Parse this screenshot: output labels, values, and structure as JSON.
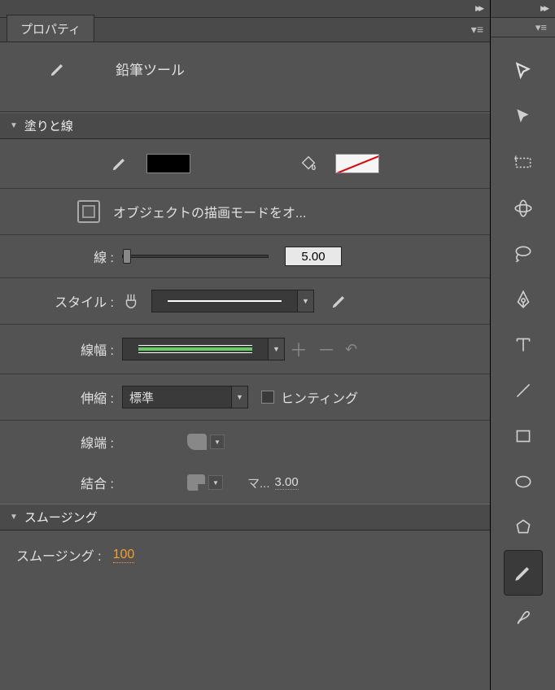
{
  "tab": {
    "title": "プロパティ"
  },
  "tool": {
    "name": "鉛筆ツール"
  },
  "sections": {
    "fillStroke": "塗りと線",
    "smoothing": "スムージング"
  },
  "drawMode": "オブジェクトの描画モードをオ...",
  "labels": {
    "stroke": "線 :",
    "style": "スタイル :",
    "width": "線幅 :",
    "scale": "伸縮 :",
    "cap": "線端 :",
    "join": "結合 :",
    "hinting": "ヒンティング",
    "miterAbbrev": "マ...",
    "smoothing": "スムージング :"
  },
  "values": {
    "strokeWeight": "5.00",
    "scale": "標準",
    "miter": "3.00",
    "smoothing": "100"
  },
  "colors": {
    "fill": "#000000",
    "stroke": "none"
  }
}
